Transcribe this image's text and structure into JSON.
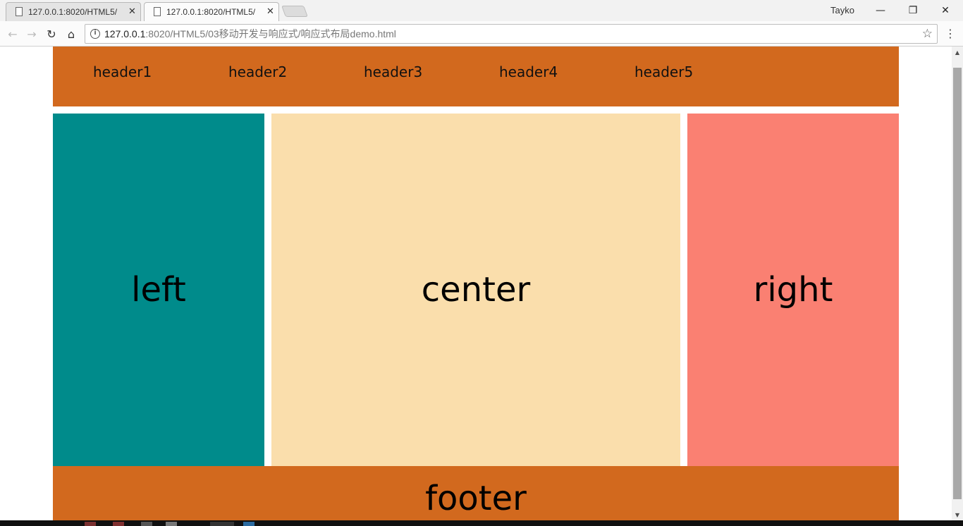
{
  "browser": {
    "tabs": [
      {
        "title": "127.0.0.1:8020/HTML5/",
        "active": false
      },
      {
        "title": "127.0.0.1:8020/HTML5/",
        "active": true
      }
    ],
    "profile_name": "Tayko",
    "window_controls": {
      "minimize": "—",
      "restore": "❐",
      "close": "✕"
    },
    "url_host": "127.0.0.1",
    "url_rest": ":8020/HTML5/03移动开发与响应式/响应式布局demo.html"
  },
  "page": {
    "header_items": [
      "header1",
      "header2",
      "header3",
      "header4",
      "header5"
    ],
    "left": "left",
    "center": "center",
    "right": "right",
    "footer": "footer"
  },
  "colors": {
    "header": "#d2691e",
    "left": "#008b8b",
    "center": "#fadeac",
    "right": "#fa8072",
    "footer": "#d2691e"
  }
}
